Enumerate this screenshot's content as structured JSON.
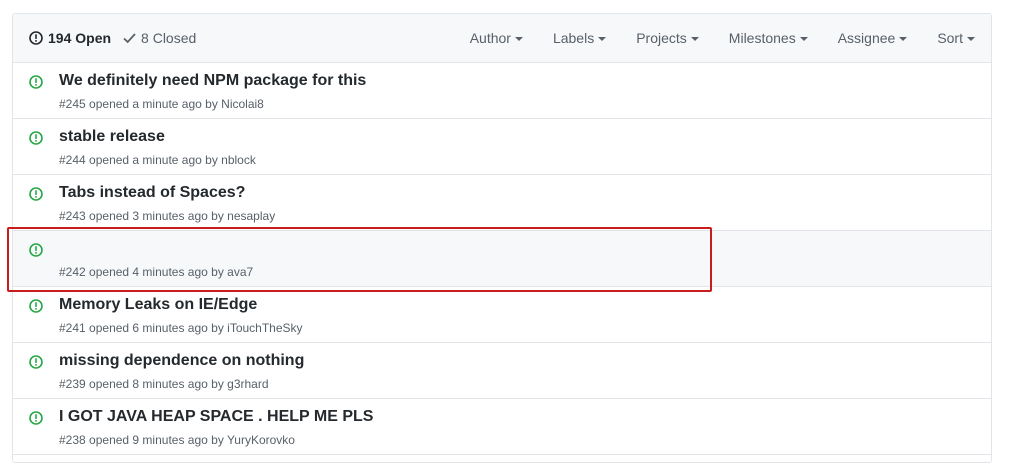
{
  "header": {
    "open_label": "194 Open",
    "closed_label": "8 Closed",
    "open_icon": "issue-opened-icon",
    "closed_icon": "check-icon",
    "filters": [
      "Author",
      "Labels",
      "Projects",
      "Milestones",
      "Assignee",
      "Sort"
    ]
  },
  "issues": [
    {
      "title": "We definitely need NPM package for this",
      "number": "#245",
      "opened": "opened a minute ago by",
      "author": "Nicolai8"
    },
    {
      "title": "stable release",
      "number": "#244",
      "opened": "opened a minute ago by",
      "author": "nblock"
    },
    {
      "title": "Tabs instead of Spaces?",
      "number": "#243",
      "opened": "opened 3 minutes ago by",
      "author": "nesaplay"
    },
    {
      "title": "",
      "number": "#242",
      "opened": "opened 4 minutes ago by",
      "author": "ava7"
    },
    {
      "title": "Memory Leaks on IE/Edge",
      "number": "#241",
      "opened": "opened 6 minutes ago by",
      "author": "iTouchTheSky"
    },
    {
      "title": "missing dependence on nothing",
      "number": "#239",
      "opened": "opened 8 minutes ago by",
      "author": "g3rhard"
    },
    {
      "title": "I GOT JAVA HEAP SPACE . HELP ME PLS",
      "number": "#238",
      "opened": "opened 9 minutes ago by",
      "author": "YuryKorovko"
    }
  ],
  "colors": {
    "open_icon": "#28a745",
    "highlight_border": "#c91c1c",
    "header_bg": "#f6f8fa"
  }
}
